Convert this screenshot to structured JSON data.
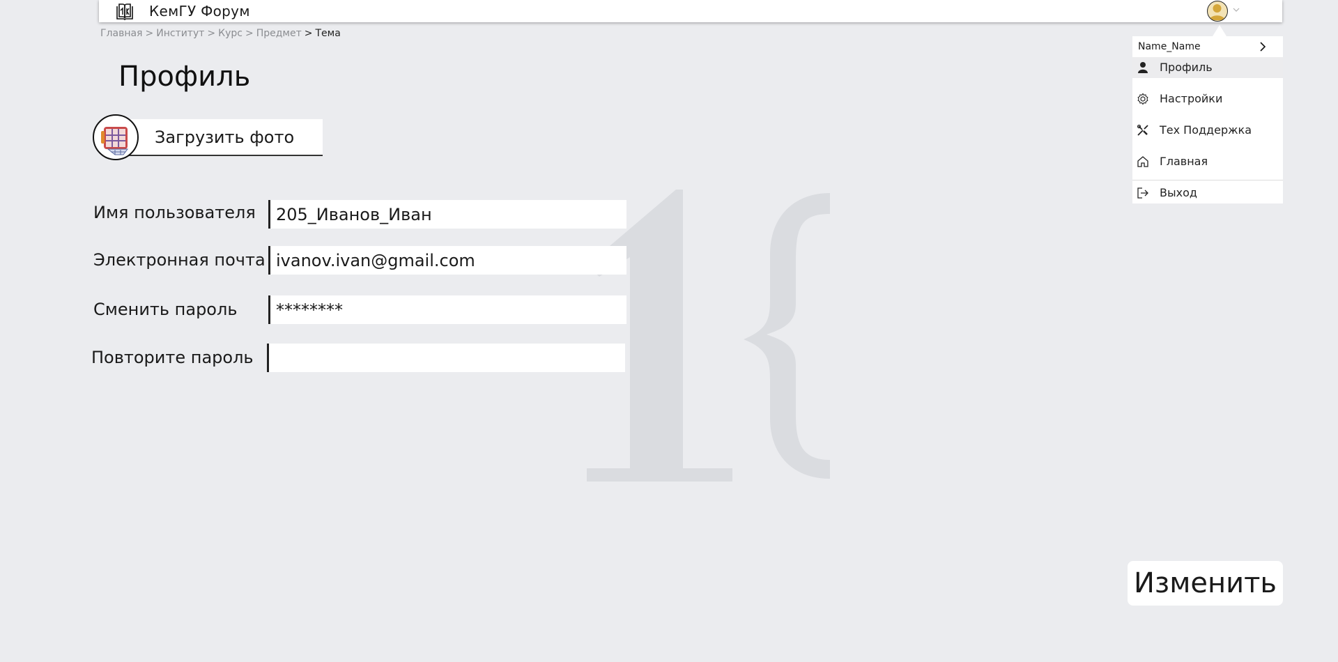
{
  "header": {
    "title": "КемГУ Форум",
    "logo_icon": "book-logo-icon",
    "avatar_icon": "user-avatar-icon",
    "chevron_icon": "chevron-down-icon"
  },
  "breadcrumb": {
    "items": [
      "Главная",
      "Институт",
      "Курс",
      "Предмет"
    ],
    "current": "Тема",
    "separator": ">"
  },
  "page": {
    "title": "Профиль",
    "upload_photo_label": "Загрузить фото"
  },
  "form": {
    "username": {
      "label": "Имя пользователя",
      "value": "205_Иванов_Иван"
    },
    "email": {
      "label": "Электронная почта",
      "value": "ivanov.ivan@gmail.com"
    },
    "password": {
      "label": "Сменить пароль",
      "value": "********"
    },
    "password_repeat": {
      "label": "Повторите пароль",
      "value": ""
    },
    "submit_label": "Изменить"
  },
  "dropdown": {
    "user_name": "Name_Name",
    "items": [
      {
        "label": "Профиль",
        "icon": "user-icon",
        "active": true
      },
      {
        "label": "Настройки",
        "icon": "gear-icon",
        "active": false
      },
      {
        "label": "Тех Поддержка",
        "icon": "tools-icon",
        "active": false
      },
      {
        "label": "Главная",
        "icon": "home-icon",
        "active": false
      },
      {
        "label": "Выход",
        "icon": "logout-icon",
        "active": false
      }
    ]
  },
  "colors": {
    "background": "#ebecef",
    "surface": "#ffffff",
    "text": "#1a1a1a",
    "muted": "#8a8c90",
    "watermark": "#dadce0"
  }
}
